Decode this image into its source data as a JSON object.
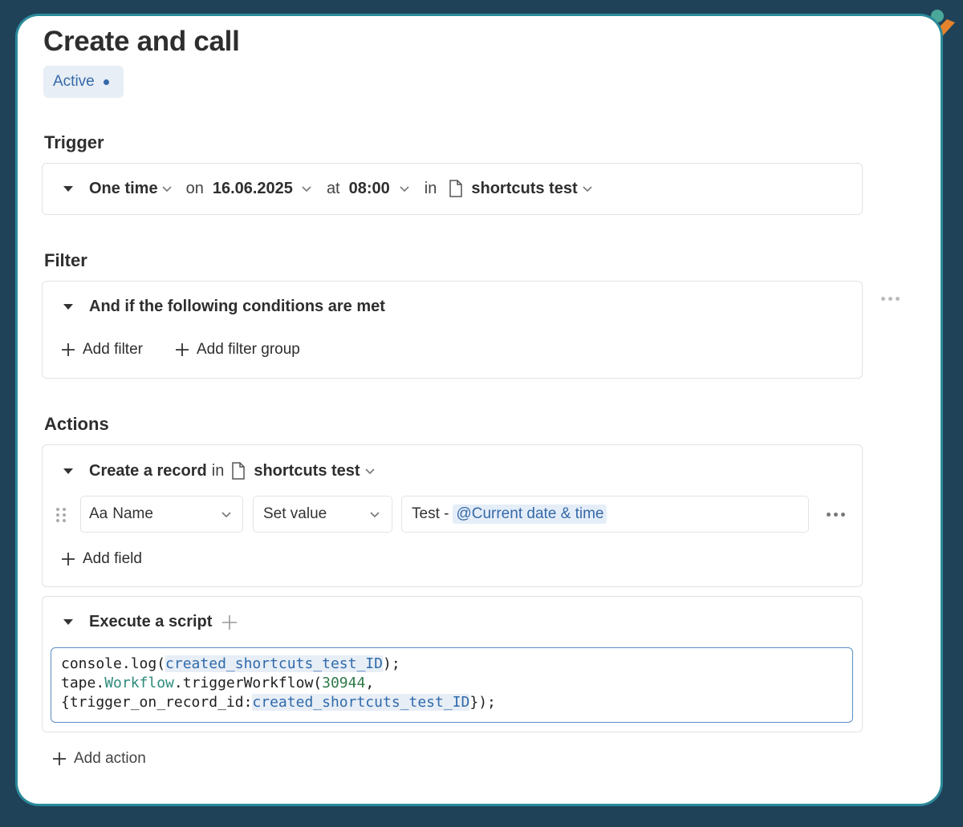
{
  "page": {
    "title": "Create and call",
    "status": "Active"
  },
  "trigger": {
    "heading": "Trigger",
    "frequency": "One time",
    "on_word": "on",
    "date": "16.06.2025",
    "at_word": "at",
    "time": "08:00",
    "in_word": "in",
    "app": "shortcuts test"
  },
  "filter": {
    "heading": "Filter",
    "condition_label": "And if the following conditions are met",
    "add_filter": "Add filter",
    "add_filter_group": "Add filter group"
  },
  "actions": {
    "heading": "Actions",
    "create_record": {
      "label": "Create a record",
      "in_word": "in",
      "app": "shortcuts test",
      "field_type_prefix": "Aa",
      "field_name": "Name",
      "operation": "Set value",
      "value_text": "Test -",
      "value_mention": "@Current date & time",
      "add_field": "Add field"
    },
    "script": {
      "label": "Execute a script",
      "line1": {
        "a": "console.log(",
        "b": "created_shortcuts_test_ID",
        "c": ");"
      },
      "line2": {
        "a": "tape.",
        "b": "Workflow",
        "c": ".triggerWorkflow(",
        "d": "30944",
        "e": ","
      },
      "line3": {
        "a": "{trigger_on_record_id:",
        "b": "created_shortcuts_test_ID",
        "c": "});"
      }
    },
    "add_action": "Add action"
  },
  "icons": {
    "caret": "caret-down-icon",
    "chevron": "chevron-down-icon",
    "document": "document-icon",
    "plus": "plus-icon",
    "drag": "drag-handle-icon",
    "more": "more-horizontal-icon"
  },
  "colors": {
    "background": "#1f4258",
    "accent": "#3569a8",
    "status_bg": "#e7eef6"
  }
}
